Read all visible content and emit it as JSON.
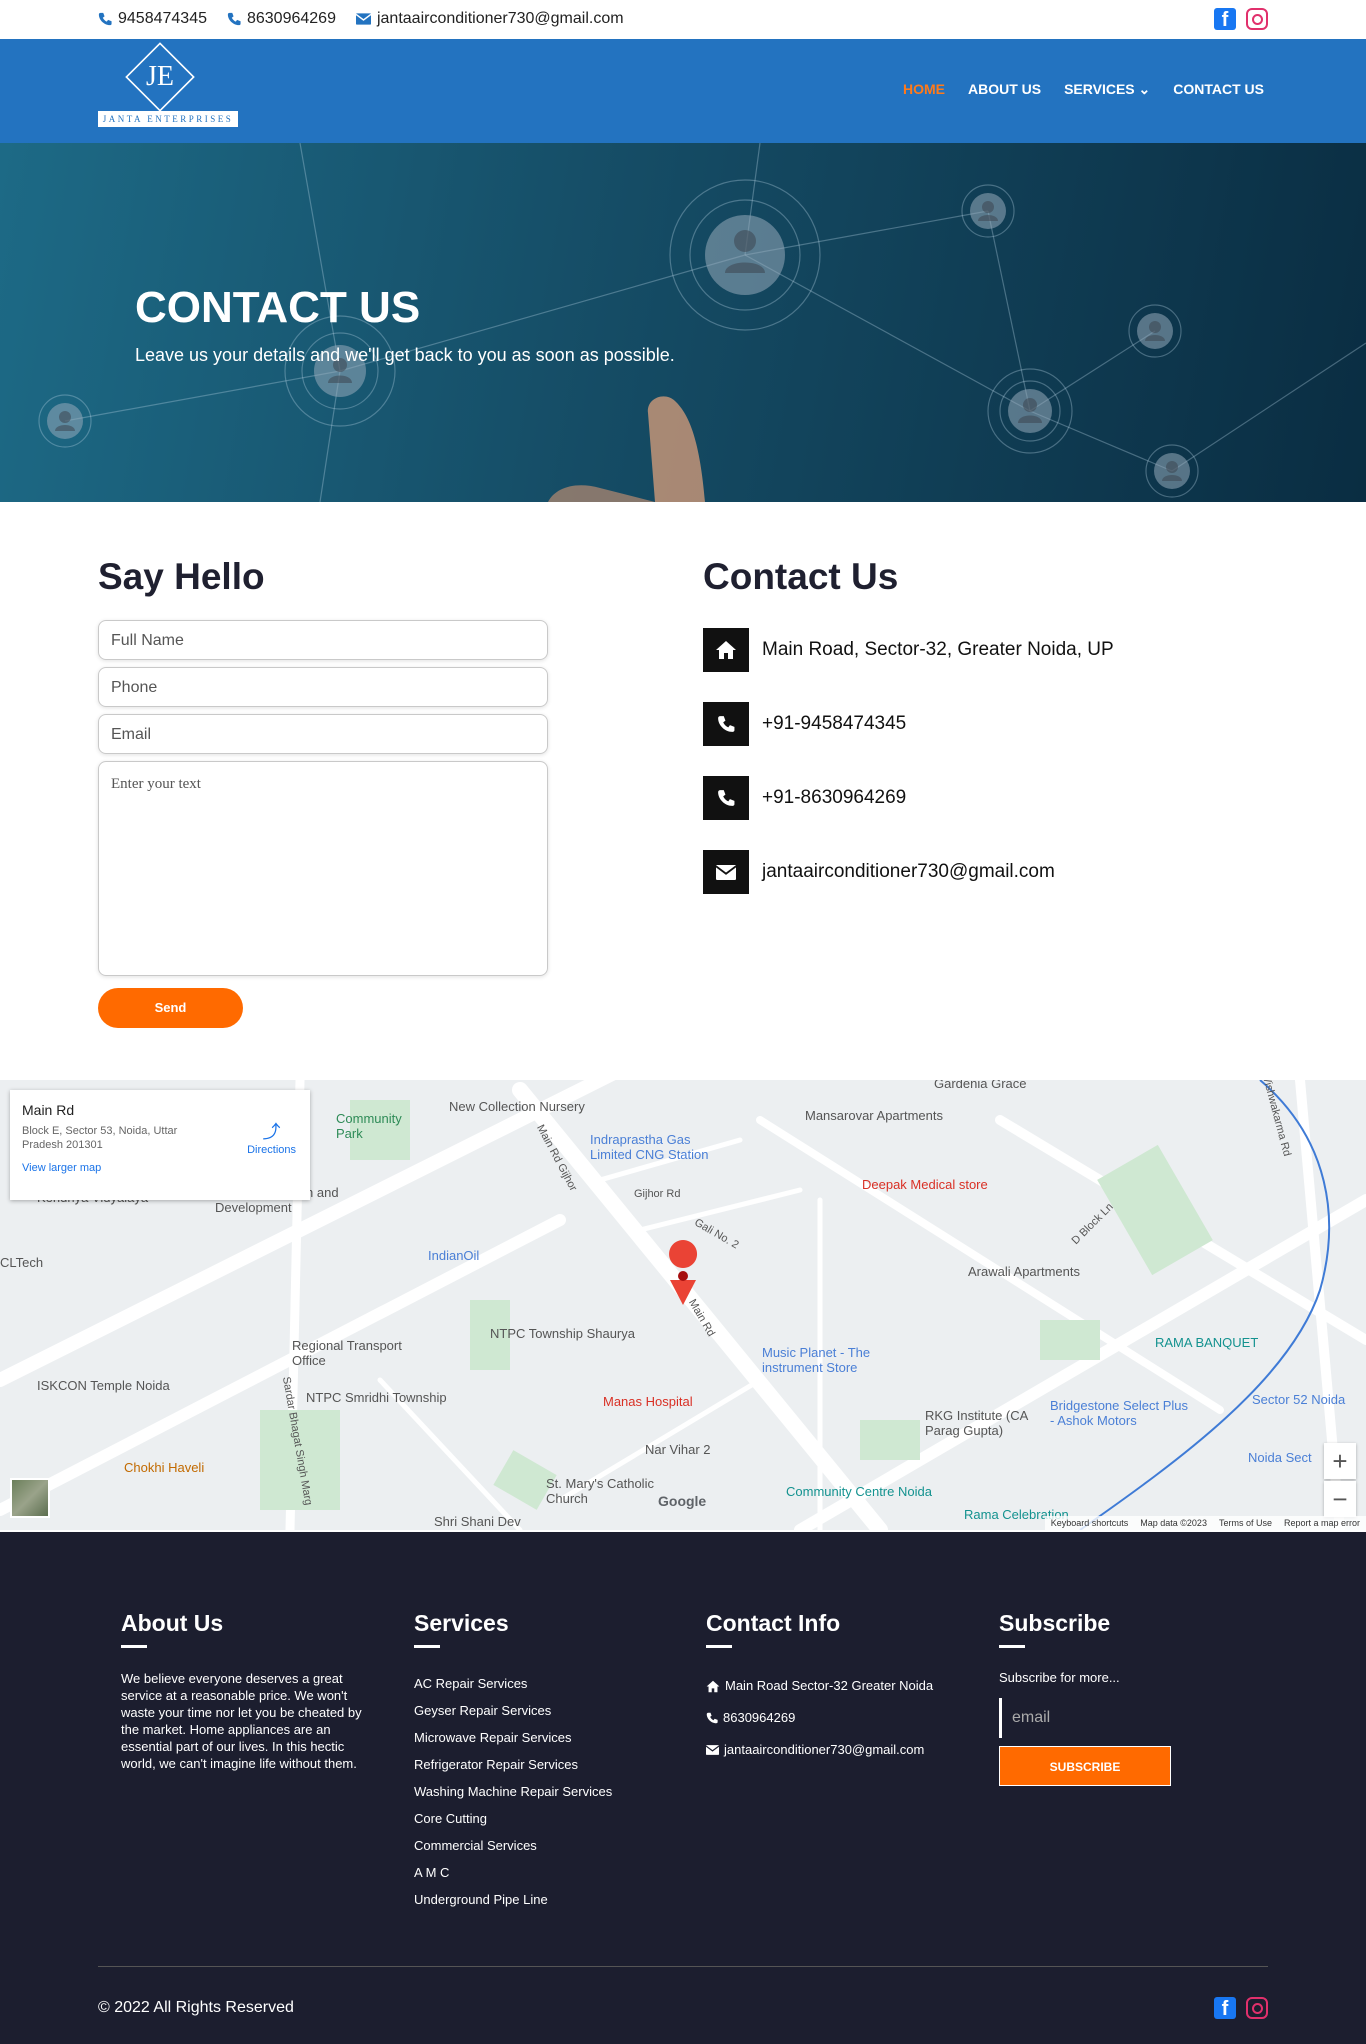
{
  "topbar": {
    "phone1": "9458474345",
    "phone2": "8630964269",
    "email": "jantaairconditioner730@gmail.com"
  },
  "nav": {
    "logo_initials": "JE",
    "logo_name": "JANTA ENTERPRISES",
    "items": [
      {
        "label": "HOME",
        "active": true
      },
      {
        "label": "ABOUT US"
      },
      {
        "label": "SERVICES"
      },
      {
        "label": "CONTACT US"
      }
    ]
  },
  "hero": {
    "title": "CONTACT US",
    "subtitle": "Leave us your details and we'll get back to you as soon as possible."
  },
  "form": {
    "heading": "Say Hello",
    "name_placeholder": "Full Name",
    "phone_placeholder": "Phone",
    "email_placeholder": "Email",
    "message_placeholder": "Enter your text",
    "send_label": "Send"
  },
  "contact": {
    "heading": "Contact Us",
    "address": "Main Road, Sector-32, Greater Noida, UP",
    "phone1": "+91-9458474345",
    "phone2": "+91-8630964269",
    "email": "jantaairconditioner730@gmail.com"
  },
  "map": {
    "card_title": "Main Rd",
    "card_address": "Block E, Sector 53, Noida, Uttar Pradesh 201301",
    "card_link": "View larger map",
    "directions": "Directions",
    "labels": [
      "New Collection Nursery",
      "Mansarovar Apartments",
      "Indraprastha Gas Limited CNG Station",
      "Deepak Medical store",
      "Kendriya Vidyalaya",
      "IndianOil",
      "Arawali Apartments",
      "NTPC Township Shaurya",
      "Regional Transport Office",
      "ISKCON Temple Noida",
      "NTPC Smridhi Township",
      "Manas Hospital",
      "Music Planet - The instrument Store",
      "RKG Institute (CA Parag Gupta)",
      "Bridgestone Select Plus - Ashok Motors",
      "RAMA BANQUET",
      "Sector 52 Noida",
      "Chokhi Haveli",
      "Nar Vihar 2",
      "St. Mary's Catholic Church",
      "Community Centre Noida",
      "Rama Celebration",
      "Community Park",
      "Main Rd Gijhor",
      "Gijhor Rd",
      "Gali No. 2",
      "D Block Ln",
      "Sardar Bhagat Singh Marg",
      "Shri Shani Dev",
      "CLTech",
      "Vishwakarma Rd",
      "Main Rd",
      "Footwear Design and Development",
      "Noida Sect",
      "Gardenia Grace"
    ],
    "footer_links": [
      "Keyboard shortcuts",
      "Map data ©2023",
      "Terms of Use",
      "Report a map error"
    ],
    "zoom_in": "+",
    "zoom_out": "−",
    "google": "Google"
  },
  "footer": {
    "about_heading": "About Us",
    "about_text": "We believe everyone deserves a great service at a reasonable price. We won't waste your time nor let you be cheated by the market. Home appliances are an essential part of our lives. In this hectic world, we can't imagine life without them.",
    "services_heading": "Services",
    "services": [
      "AC Repair Services",
      "Geyser Repair Services",
      "Microwave Repair Services",
      "Refrigerator Repair Services",
      "Washing Machine Repair Services",
      "Core Cutting",
      "Commercial Services",
      "A M C",
      "Underground Pipe Line"
    ],
    "contact_heading": "Contact Info",
    "contact_address": "Main Road Sector-32 Greater Noida",
    "contact_phone": "8630964269",
    "contact_email": "jantaairconditioner730@gmail.com",
    "subscribe_heading": "Subscribe",
    "subscribe_text": "Subscribe for more...",
    "email_placeholder": "email",
    "subscribe_button": "SUBSCRIBE",
    "copyright": "© 2022 All Rights Reserved"
  },
  "colors": {
    "nav_blue": "#2373c0",
    "accent_orange": "#ff6a00",
    "footer_bg": "#1c1e2f"
  }
}
